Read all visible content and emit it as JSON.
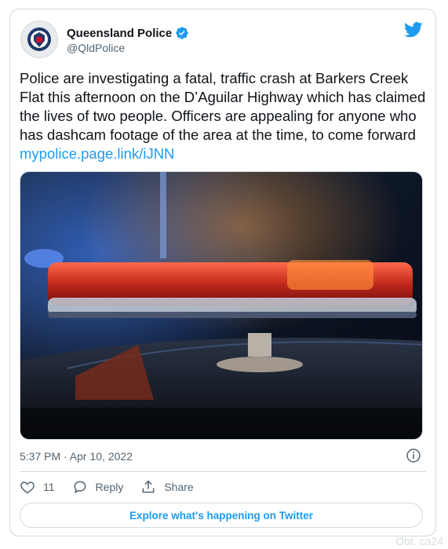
{
  "account": {
    "name": "Queensland Police",
    "handle": "@QldPolice"
  },
  "tweet": {
    "text": "Police are investigating a fatal, traffic crash at Barkers Creek Flat this afternoon on the D’Aguilar Highway which has claimed the lives of two people. Officers are appealing for anyone  who has dashcam footage of the area at the time, to come forward ",
    "link": "mypolice.page.link/iJNN",
    "timestamp": "5:37 PM · Apr 10, 2022"
  },
  "actions": {
    "likes_count": "11",
    "reply_label": "Reply",
    "share_label": "Share"
  },
  "explore_label": "Explore what's happening on Twitter",
  "watermark": "Obt. ca24",
  "colors": {
    "accent": "#1d9bf0",
    "text": "#0f1419",
    "muted": "#536471",
    "border": "#cfd9de"
  },
  "icons": [
    "police-badge-icon",
    "verified-icon",
    "twitter-bird-icon",
    "info-icon",
    "heart-icon",
    "reply-icon",
    "share-icon"
  ]
}
